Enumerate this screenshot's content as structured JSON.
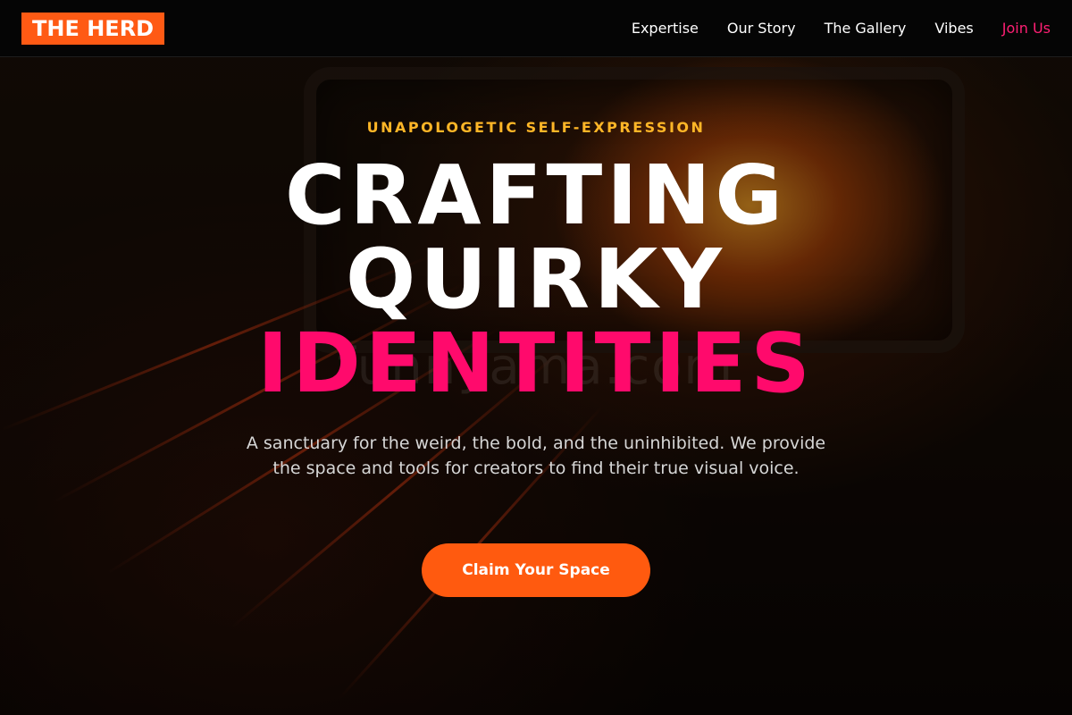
{
  "header": {
    "logo": "THE HERD",
    "nav": [
      {
        "label": "Expertise"
      },
      {
        "label": "Our Story"
      },
      {
        "label": "The Gallery"
      },
      {
        "label": "Vibes"
      },
      {
        "label": "Join Us"
      }
    ]
  },
  "hero": {
    "eyebrow": "UNAPOLOGETIC SELF-EXPRESSION",
    "headline_line1": "CRAFTING",
    "headline_line2": "QUIRKY",
    "headline_line3": "IDENTITIES",
    "tagline": "A sanctuary for the weird, the bold, and the uninhibited. We provide the space and tools for creators to find their true visual voice.",
    "cta_label": "Claim Your Space",
    "watermark": "funnyama.com"
  },
  "colors": {
    "brand_orange": "#ff5a14",
    "accent_pink": "#ff0a6c",
    "eyebrow_gold": "#ffb627"
  }
}
